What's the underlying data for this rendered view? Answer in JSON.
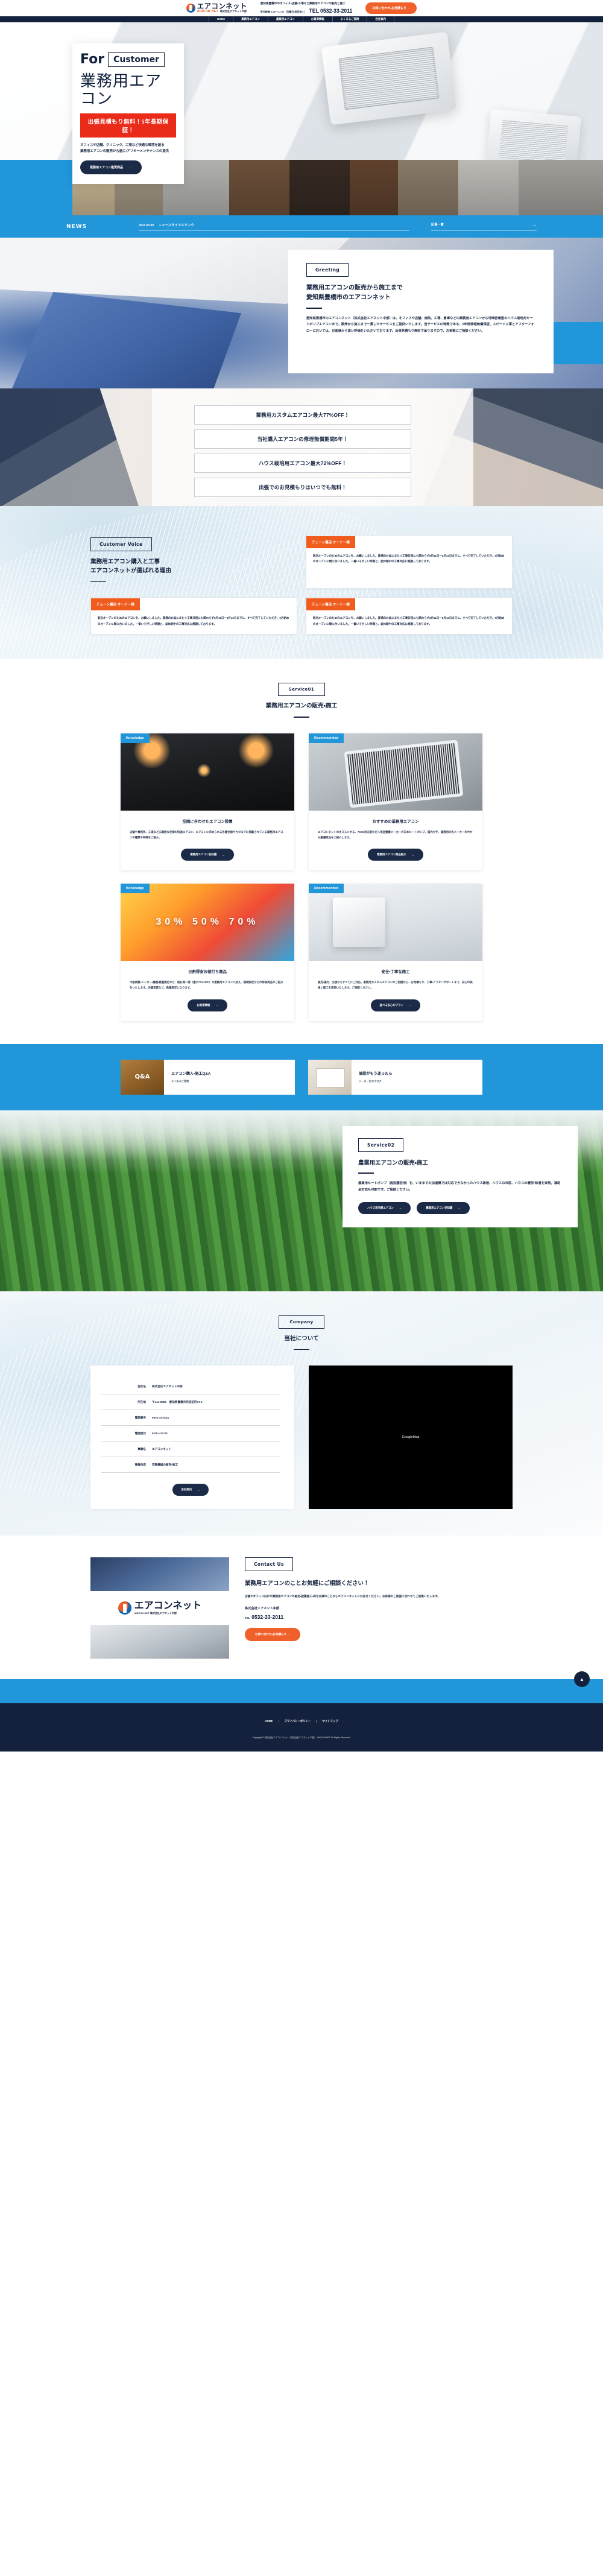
{
  "header": {
    "logo_title": "エアコンネット",
    "logo_sub_en": "AIRCON NET",
    "logo_sub_jp": "株式会社エアネット中部",
    "tagline": "愛知県豊橋市のオフィス・店舗・工場など業務用エアコンの販売と施工",
    "hours": "受付時間 9:00〜17:00（日曜日・祝日除く）",
    "tel": "TEL 0532-33-2011",
    "cta": "お問い合わせ・お見積もり →"
  },
  "nav": {
    "items": [
      {
        "label": "HOME"
      },
      {
        "label": "業務用エアコン"
      },
      {
        "label": "農業用エアコン"
      },
      {
        "label": "お買得情報"
      },
      {
        "label": "よくあるご質問"
      },
      {
        "label": "会社案内"
      }
    ]
  },
  "hero": {
    "for": "For",
    "customer": "Customer",
    "title": "業務用エアコン",
    "badge": "出張見積もり無料！5年長期保証！",
    "desc_line1": "オフィスや店舗、クリニック、工場など快適な環境を創る",
    "desc_line2": "業務用エアコンの販売から施工・アフターメンテナンスの提供",
    "button": "業務用エアコン推奨商品",
    "button_arrow": "→"
  },
  "news": {
    "label": "NEWS",
    "date": "2021.00.00",
    "title": "ニュースタイトルリンク",
    "more": "記事一覧",
    "arrow": "→"
  },
  "greeting": {
    "tag": "Greeting",
    "heading_line1": "業務用エアコンの販売から施工まで",
    "heading_line2": "愛知県豊橋市のエアコンネット",
    "body": "愛知県豊橋市のエアコンネット（株式会社エアネット中部）は、オフィスや店舗、病院、工場、倉庫などの業務用エアコンから地域密着型のハウス栽培用ヒートポンプエアコンまで、販売から施工まで一貫したサービスをご提供いたします。当サービスの特徴である、5年間修理無償保証、スピード工事とアフターフォローにおいては、お客様から高い評価をいただいております。出張見積もり無料で承りますので、お気軽にご相談ください。"
  },
  "points": {
    "items": [
      {
        "label": "業務用カスタムエアコン最大77%OFF！"
      },
      {
        "label": "当社購入エアコンの修理無償期間5年！"
      },
      {
        "label": "ハウス栽培用エアコン最大72%OFF！"
      },
      {
        "label": "出張でのお見積もりはいつでも無料！"
      }
    ]
  },
  "voice": {
    "tag": "Customer Voice",
    "heading_line1": "業務用エアコン購入と工事",
    "heading_line2": "エアコンネットが選ばれる理由",
    "cards": [
      {
        "owner": "チェーン書店 オーナー様",
        "text": "新店オープンのためのエアコンを、お願いしました。夏場のお盆にまたぐ工事日程にも関わらず8月11日〜8月15日までに、すべて完了していただき、9月始めのオープンに間に合いました。一番いそがしい時期と、盆休期中の工事対応に感謝しております。"
      },
      {
        "owner": "チェーン書店 オーナー様",
        "text": "新店オープンのためのエアコンを、お願いしました。夏場のお盆にまたぐ工事日程にも関わらず8月11日〜8月15日までに、すべて完了していただき、9月始めのオープンに間に合いました。一番いそがしい時期と、盆休期中の工事対応に感謝しております。"
      },
      {
        "owner": "チェーン書店 オーナー様",
        "text": "新店オープンのためのエアコンを、お願いしました。夏場のお盆にまたぐ工事日程にも関わらず8月11日〜8月15日までに、すべて完了していただき、9月始めのオープンに間に合いました。一番いそがしい時期と、盆休期中の工事対応に感謝しております。"
      }
    ]
  },
  "service01": {
    "tag": "Service01",
    "heading": "業務用エアコンの販売・施工",
    "cards": [
      {
        "badge": "Knowledge",
        "title": "空間に合わせたエアコン設置",
        "text": "店舗や事務所、工場など広範囲な空間の快適エアコン、エアコンに求められる各種仕様やカタログに掲載されている業務用エアコンの種類や特徴をご紹介。",
        "button": "業務用エアコン豆知識"
      },
      {
        "badge": "Recommended",
        "title": "おすすめの業務用エアコン",
        "text": "エアコンネットのオススメする、750M対応型のビル用変頻機メーカーの日本ヒートポンプ、国内大手、業務用の各メーカーの中から厳選商品をご紹介します。",
        "button": "業務用エアコン商品紹介"
      },
      {
        "badge": "Knowledge",
        "title": "日割得安お値打ち商品",
        "text": "中堅規模・メーカー・機種・数量限定など、超お買い得（最大77%OFF）な業務用エアコンに加え、期間限定などの特価商品のご紹介をいたします。店舗営業など、数量限定となります。",
        "button": "お買得情報"
      },
      {
        "badge": "Recommended",
        "title": "安全・丁寧な施工",
        "text": "販売・据付、交換からすべてにご対応。業務用カスタムエアコンのご相談から、お見積もり、工事・アフターサポートまで、安心の価格と施工を実現いたします。ご相談ください。",
        "button": "選べる安心のプラン"
      }
    ]
  },
  "qa": {
    "cards": [
      {
        "icon": "Q&A",
        "title": "エアコン購入・施工Q&A",
        "sub": "よくあるご質問"
      },
      {
        "icon": "catalog",
        "title": "値段がもう迷ったら",
        "sub": "メーカー別カタログ"
      }
    ]
  },
  "service02": {
    "tag": "Service02",
    "heading": "農業用エアコンの販売・施工",
    "body": "農業用ヒートポンプ（施設園芸用）を、いままでの加温機では対応できなかったハウス栽培、ハウスの冷房、ハウスの暖房・除湿を実現。補助金対応も可能です。ご相談ください。",
    "buttons": [
      {
        "label": "ハウス用冷暖エアコン"
      },
      {
        "label": "農業用エアコン豆知識"
      }
    ]
  },
  "company": {
    "tag": "Company",
    "heading": "当社について",
    "rows": [
      {
        "key": "会社名",
        "value": "株式会社エアネット中部"
      },
      {
        "key": "所在地",
        "value": "〒441-8081　愛知県豊橋市西羽田町73-1"
      },
      {
        "key": "電話番号",
        "value": "0532-33-2011"
      },
      {
        "key": "電話受付",
        "value": "9:00〜17:00"
      },
      {
        "key": "事業名",
        "value": "エアコンネット"
      },
      {
        "key": "事業内容",
        "value": "空調機器の販売・施工"
      }
    ],
    "button": "会社案内",
    "map_label": "GoogleMap"
  },
  "contact": {
    "tag": "Contact Us",
    "heading": "業務用エアコンのことお気軽にご相談ください！",
    "body": "店舗やオフィス向けの業務用エアコンの販売・設置施工・保守点検のことならエアコンネットにお任せください。お客様のご要望に合わせてご提案いたします。",
    "company": "株式会社エアネット中部",
    "tel_label": "TEL",
    "tel": "0532-33-2011",
    "button": "お問い合わせ・お見積もり →",
    "logo_title": "エアコンネット",
    "logo_sub_en": "AIRCON NET",
    "logo_sub_jp": "株式会社エアネット中部"
  },
  "footer": {
    "links": [
      {
        "label": "HOME"
      },
      {
        "label": "プライバシーポリシー"
      },
      {
        "label": "サイトマップ"
      }
    ],
    "copyright": "Copyright © 株式会社エアコンネット（株式会社エアネット中部） AIRCON NET All Rights Reserved."
  },
  "colors": {
    "blue": "#2196d9",
    "navy": "#13213d",
    "orange": "#f0602a",
    "red": "#ea2b19"
  }
}
